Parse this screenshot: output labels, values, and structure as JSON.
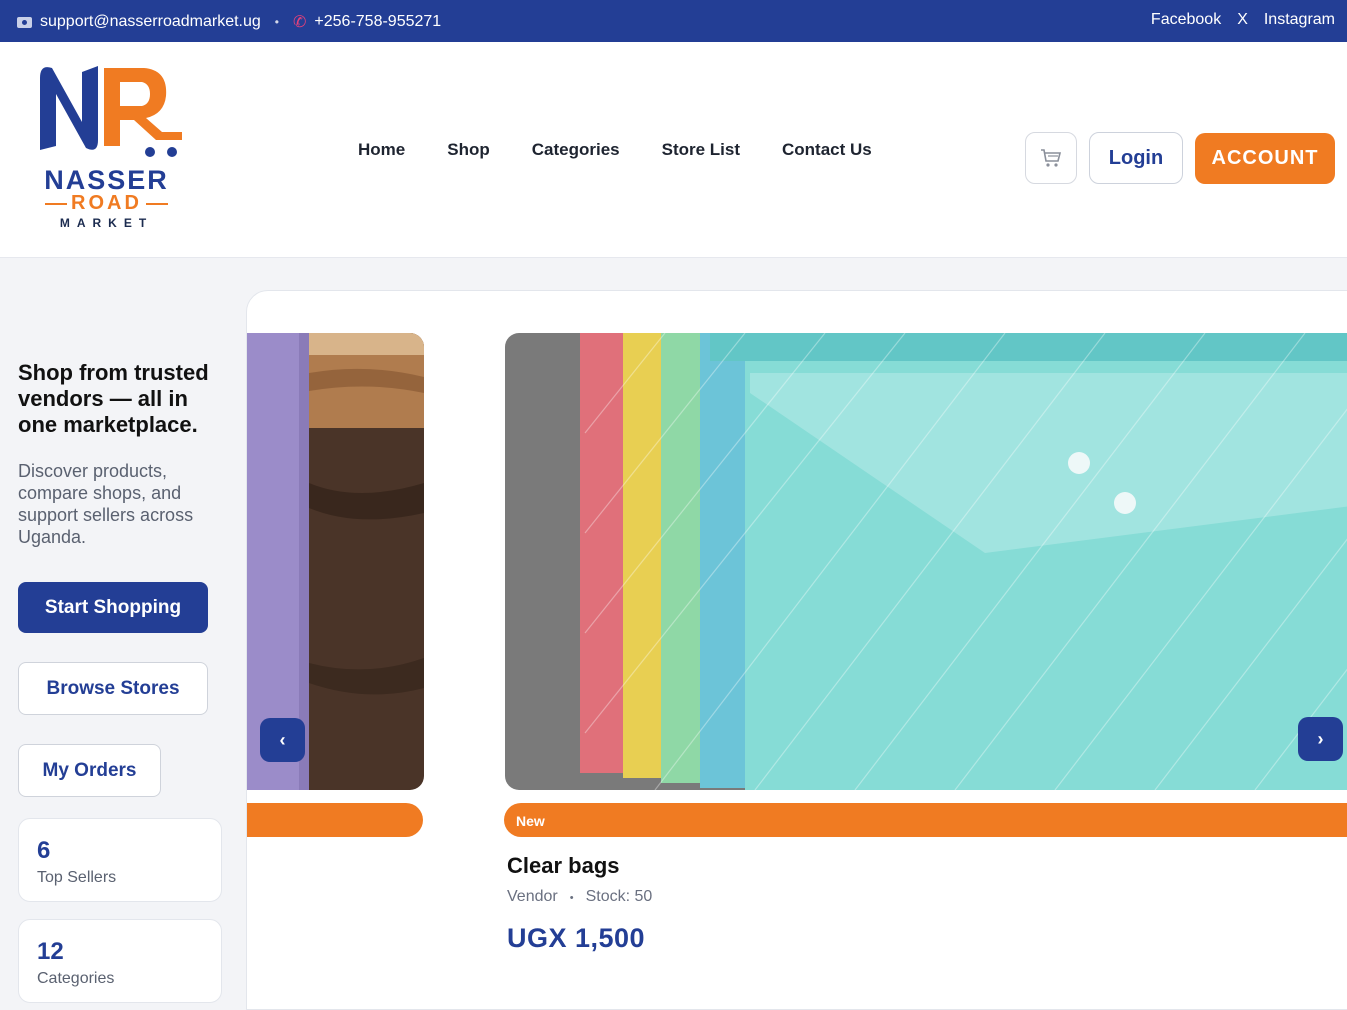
{
  "topbar": {
    "email": "support@nasserroadmarket.ug",
    "phone": "+256-758-955271",
    "social": [
      "Facebook",
      "X",
      "Instagram"
    ]
  },
  "logo": {
    "line1": "NASSER",
    "line2": "ROAD",
    "line3": "MARKET"
  },
  "nav": [
    "Home",
    "Shop",
    "Categories",
    "Store List",
    "Contact Us"
  ],
  "header": {
    "cart_icon": "cart-icon",
    "login_label": "Login",
    "account_label": "ACCOUNT"
  },
  "hero": {
    "title": "Shop from trusted vendors — all in one marketplace.",
    "subtitle": "Discover products, compare shops, and support sellers across Uganda.",
    "start_shopping": "Start Shopping",
    "browse_stores": "Browse Stores",
    "my_orders": "My Orders"
  },
  "stats": [
    {
      "value": "6",
      "label": "Top Sellers"
    },
    {
      "value": "12",
      "label": "Categories"
    }
  ],
  "carousel": {
    "prev_label": "‹",
    "next_label": "›",
    "product": {
      "badge": "New",
      "title": "Clear bags",
      "vendor": "Vendor",
      "stock": "Stock: 50",
      "price": "UGX 1,500"
    }
  },
  "colors": {
    "brand_blue": "#233e95",
    "brand_orange": "#f07b22"
  }
}
